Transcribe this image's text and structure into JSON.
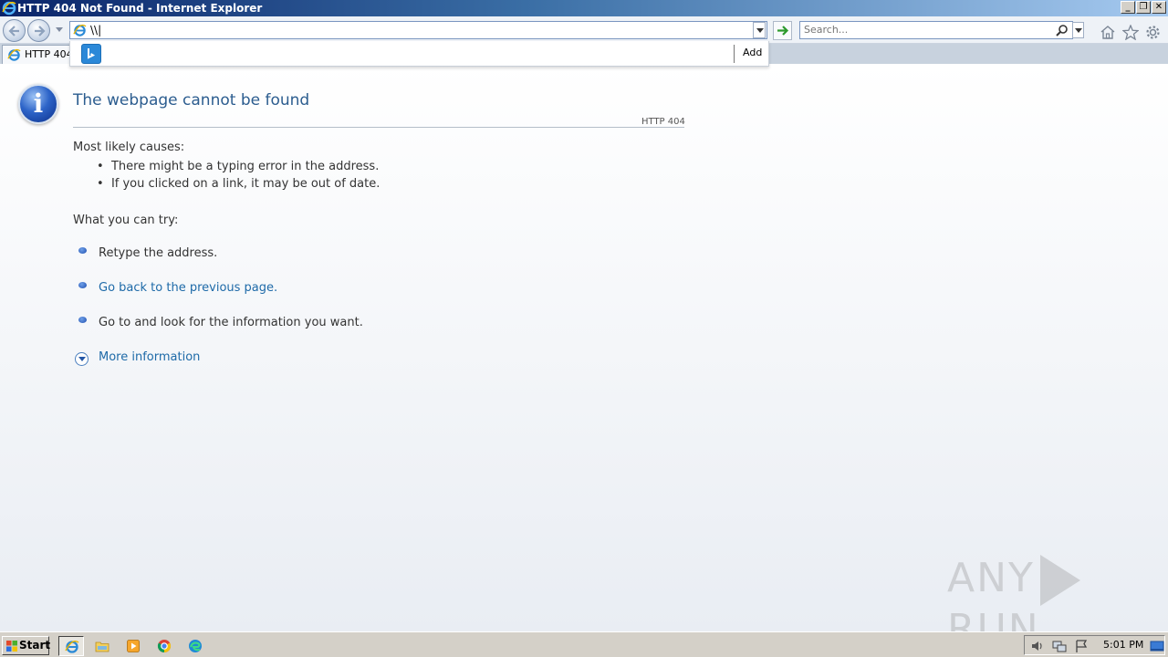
{
  "window": {
    "title": "HTTP 404 Not Found - Internet Explorer",
    "minimize_label": "_",
    "maximize_label": "❐",
    "close_label": "✕"
  },
  "navbar": {
    "address_value": "\\\\|",
    "search_placeholder": "Search..."
  },
  "tab": {
    "label": "HTTP 404"
  },
  "suggestion": {
    "add_label": "Add"
  },
  "page": {
    "heading": "The webpage cannot be found",
    "code": "HTTP 404",
    "causes_title": "Most likely causes:",
    "causes": [
      "There might be a typing error in the address.",
      "If you clicked on a link, it may be out of date."
    ],
    "try_title": "What you can try:",
    "try_items": [
      "Retype the address.",
      "Go back to the previous page.",
      "Go to  and look for the information you want."
    ],
    "more_info": "More information",
    "info_icon_glyph": "i"
  },
  "watermark": {
    "left": "ANY",
    "right": "RUN"
  },
  "taskbar": {
    "start_label": "Start",
    "clock": "5:01 PM"
  },
  "colors": {
    "heading": "#2c5d8f",
    "link": "#1e6aa8",
    "titlebar_start": "#0a246a",
    "taskbar": "#d4d0c8"
  },
  "icons": [
    "ie-icon",
    "back-icon",
    "forward-icon",
    "go-arrow-icon",
    "search-icon",
    "home-icon",
    "favorites-star-icon",
    "tools-gear-icon",
    "bing-icon",
    "info-icon",
    "expand-icon",
    "explorer-folder-icon",
    "media-player-icon",
    "chrome-icon",
    "edge-icon",
    "volume-icon",
    "network-icon",
    "flag-icon",
    "show-desktop-icon"
  ]
}
